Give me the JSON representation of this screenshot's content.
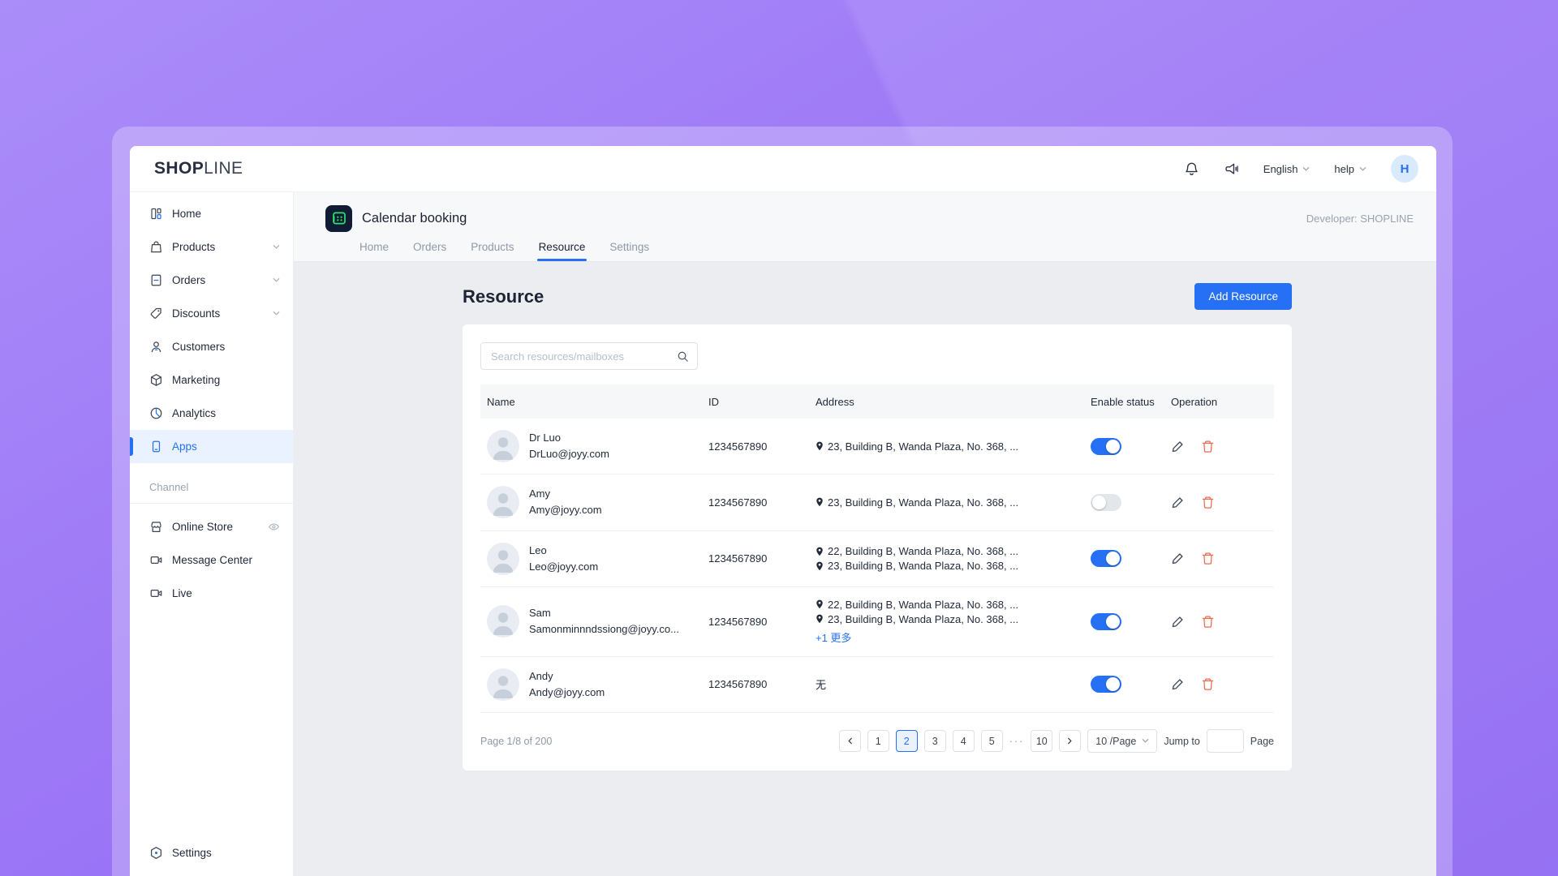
{
  "logo": {
    "bold": "SHOP",
    "light": "LINE"
  },
  "topbar": {
    "language": "English",
    "help": "help",
    "avatar_initial": "H"
  },
  "sidebar": {
    "items": [
      {
        "label": "Home"
      },
      {
        "label": "Products",
        "expandable": true
      },
      {
        "label": "Orders",
        "expandable": true
      },
      {
        "label": "Discounts",
        "expandable": true
      },
      {
        "label": "Customers"
      },
      {
        "label": "Marketing"
      },
      {
        "label": "Analytics"
      },
      {
        "label": "Apps",
        "active": true
      }
    ],
    "section": "Channel",
    "channel_items": [
      {
        "label": "Online Store",
        "has_eye": true
      },
      {
        "label": "Message Center"
      },
      {
        "label": "Live"
      }
    ],
    "settings": "Settings"
  },
  "app": {
    "title": "Calendar booking",
    "developer": "Developer: SHOPLINE",
    "tabs": [
      {
        "label": "Home"
      },
      {
        "label": "Orders"
      },
      {
        "label": "Products"
      },
      {
        "label": "Resource",
        "active": true
      },
      {
        "label": "Settings"
      }
    ]
  },
  "page": {
    "title": "Resource",
    "add_button": "Add Resource",
    "search_placeholder": "Search resources/mailboxes"
  },
  "table": {
    "headers": [
      "Name",
      "ID",
      "Address",
      "Enable status",
      "Operation"
    ],
    "rows": [
      {
        "name": "Dr Luo",
        "email": "DrLuo@joyy.com",
        "id": "1234567890",
        "address1": "23, Building B, Wanda Plaza, No. 368, ...",
        "enabled": true
      },
      {
        "name": "Amy",
        "email": "Amy@joyy.com",
        "id": "1234567890",
        "address1": "23, Building B, Wanda Plaza, No. 368, ...",
        "enabled": false
      },
      {
        "name": "Leo",
        "email": "Leo@joyy.com",
        "id": "1234567890",
        "address1": "22, Building B, Wanda Plaza, No. 368, ...",
        "address2": "23, Building B, Wanda Plaza, No. 368, ...",
        "enabled": true
      },
      {
        "name": "Sam",
        "email": "Samonminnndssiong@joyy.co...",
        "id": "1234567890",
        "address1": "22, Building B, Wanda Plaza, No. 368, ...",
        "address2": "23, Building B, Wanda Plaza, No. 368, ...",
        "more_link": "+1 更多",
        "enabled": true
      },
      {
        "name": "Andy",
        "email": "Andy@joyy.com",
        "id": "1234567890",
        "no_address": "无",
        "enabled": true
      }
    ]
  },
  "pagination": {
    "summary": "Page 1/8 of 200",
    "pages": [
      "1",
      "2",
      "3",
      "4",
      "5"
    ],
    "active_page": "2",
    "ellipsis": "···",
    "last_page": "10",
    "per_page": "10 /Page",
    "jump_to": "Jump to",
    "page_word": "Page"
  },
  "colors": {
    "accent": "#2570f4",
    "danger": "#ed6a4d",
    "toggle_off": "#e3e7ec"
  }
}
